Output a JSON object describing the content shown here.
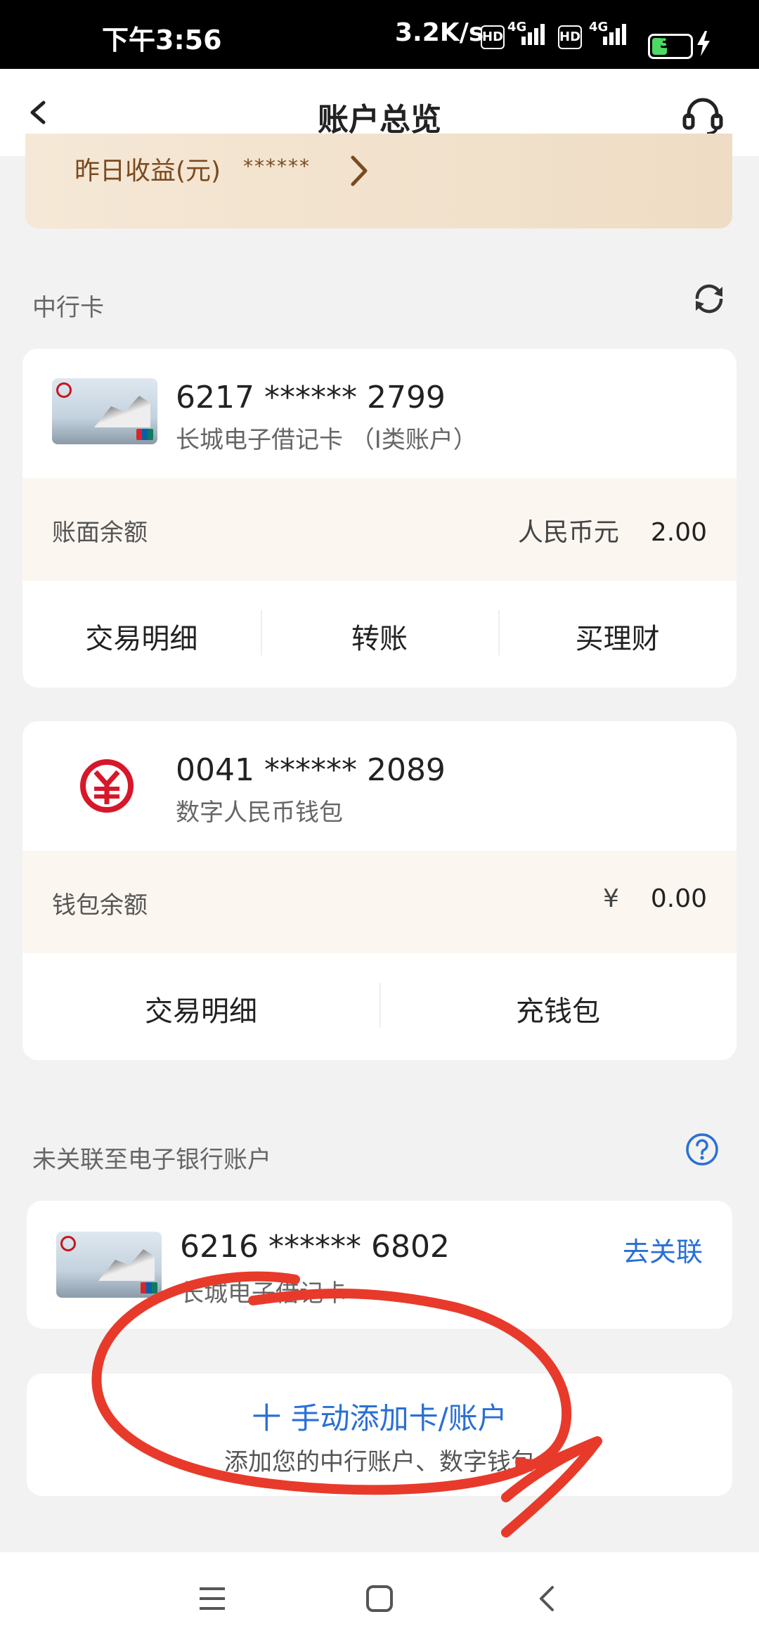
{
  "status_bar": {
    "time": "下午3:56",
    "speed": "3.2K/s",
    "hd1": "HD",
    "net1": "4G",
    "hd2": "HD",
    "net2": "4G",
    "battery": "37"
  },
  "header": {
    "title": "账户总览",
    "back_icon": "chevron-left-icon",
    "service_icon": "headset-icon"
  },
  "yesterday": {
    "label": "昨日收益(元)",
    "masked_value": "******"
  },
  "boc_section": {
    "title": "中行卡",
    "refresh_icon": "refresh-icon",
    "cards": [
      {
        "number": "6217 ****** 2799",
        "type": "长城电子借记卡 （I类账户）",
        "balance_label": "账面余额",
        "currency": "人民币元",
        "balance": "2.00",
        "actions": [
          "交易明细",
          "转账",
          "买理财"
        ]
      },
      {
        "number": "0041 ****** 2089",
        "type": "数字人民币钱包",
        "balance_label": "钱包余额",
        "currency": "¥",
        "balance": "0.00",
        "actions": [
          "交易明细",
          "充钱包"
        ]
      }
    ]
  },
  "unlinked_section": {
    "title": "未关联至电子银行账户",
    "help_icon": "help-icon",
    "card": {
      "number": "6216 ****** 6802",
      "type": "长城电子借记卡",
      "link_label": "去关联"
    }
  },
  "add_card": {
    "label": "十 手动添加卡/账户",
    "sub": "添加您的中行账户、数字钱包"
  },
  "colors": {
    "accent_blue": "#2a6fd6",
    "annotation_red": "#e83a2a",
    "balance_row_bg": "#fbf6f0"
  }
}
